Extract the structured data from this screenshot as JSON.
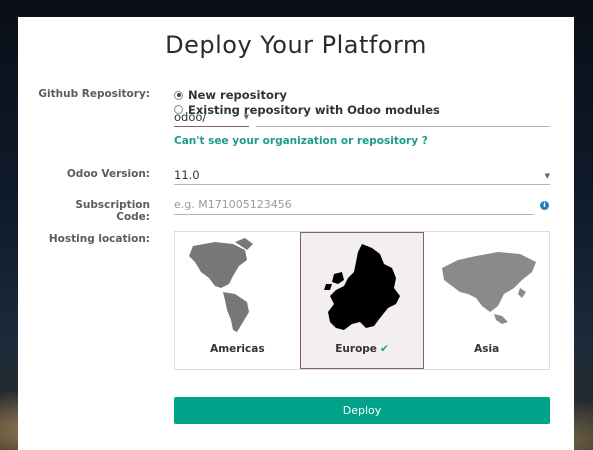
{
  "title": "Deploy Your Platform",
  "labels": {
    "github": "Github Repository:",
    "version": "Odoo Version:",
    "subscription": "Subscription Code:",
    "hosting": "Hosting location:"
  },
  "repo_options": {
    "new_label": "New repository",
    "existing_label": "Existing repository with Odoo modules",
    "selected": "new"
  },
  "org_select": {
    "value": "odoo/"
  },
  "repo_input": {
    "value": ""
  },
  "org_link": "Can't see your organization or repository ?",
  "version_select": {
    "value": "11.0"
  },
  "subscription_input": {
    "placeholder": "e.g. M171005123456"
  },
  "hosting": {
    "options": [
      "Americas",
      "Europe",
      "Asia"
    ],
    "selected": "Europe",
    "selected_mark": "✔"
  },
  "deploy_button": "Deploy",
  "colors": {
    "accent": "#00a38a",
    "brand": "#875a7b"
  }
}
